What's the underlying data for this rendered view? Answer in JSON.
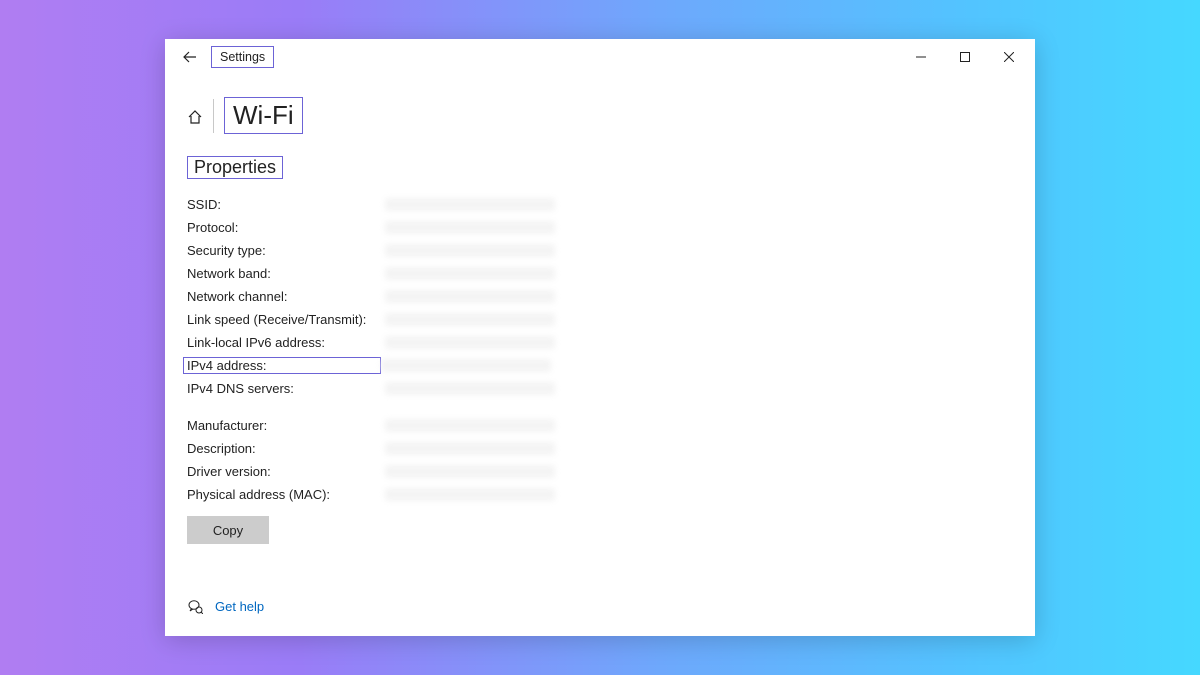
{
  "app": {
    "title": "Settings"
  },
  "page": {
    "title": "Wi-Fi",
    "section": "Properties"
  },
  "props": {
    "group1": [
      {
        "label": "SSID:"
      },
      {
        "label": "Protocol:"
      },
      {
        "label": "Security type:"
      },
      {
        "label": "Network band:"
      },
      {
        "label": "Network channel:"
      },
      {
        "label": "Link speed (Receive/Transmit):"
      },
      {
        "label": "Link-local IPv6 address:"
      },
      {
        "label": "IPv4 address:",
        "boxed": true
      },
      {
        "label": "IPv4 DNS servers:"
      }
    ],
    "group2": [
      {
        "label": "Manufacturer:"
      },
      {
        "label": "Description:"
      },
      {
        "label": "Driver version:"
      },
      {
        "label": "Physical address (MAC):"
      }
    ]
  },
  "buttons": {
    "copy": "Copy"
  },
  "help": {
    "label": "Get help"
  }
}
